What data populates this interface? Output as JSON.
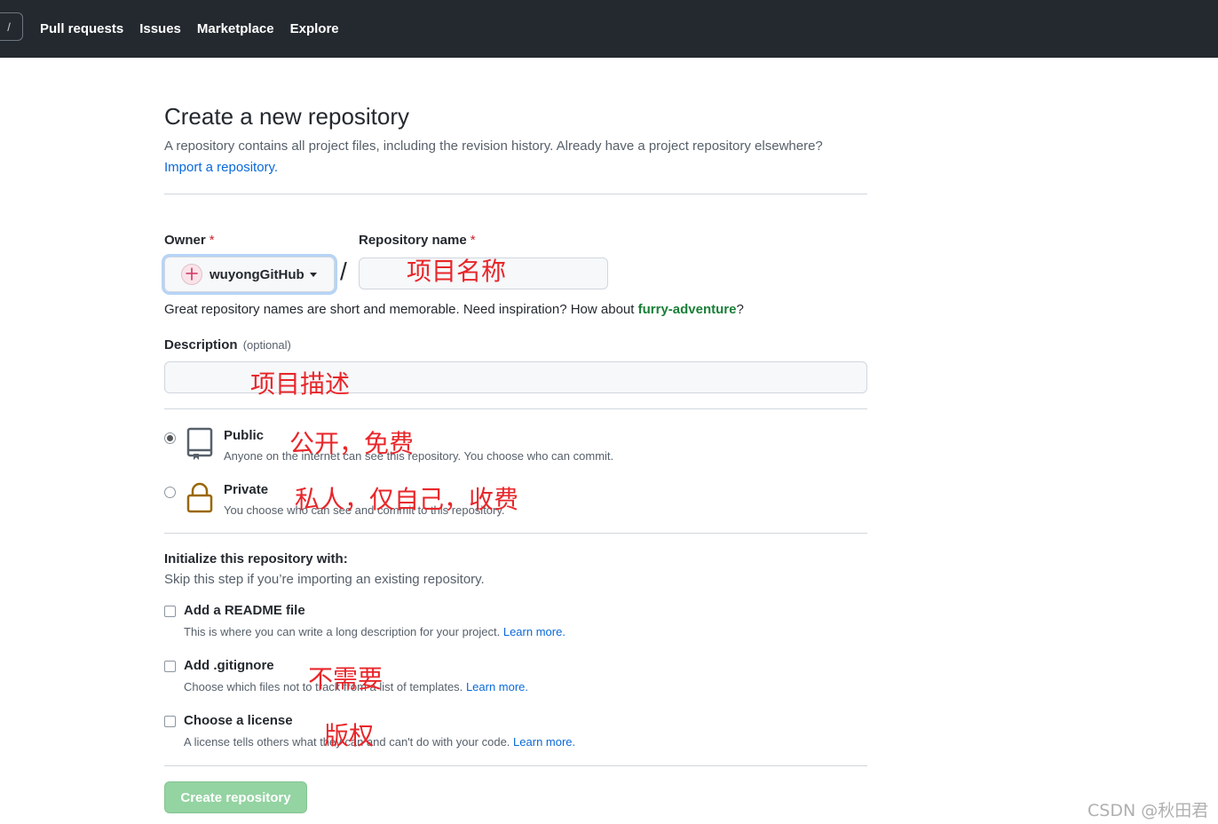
{
  "header": {
    "shortcut_key": "/",
    "nav": [
      "Pull requests",
      "Issues",
      "Marketplace",
      "Explore"
    ]
  },
  "page": {
    "title": "Create a new repository",
    "subtitle": "A repository contains all project files, including the revision history. Already have a project repository elsewhere?",
    "import_link": "Import a repository."
  },
  "owner": {
    "label": "Owner",
    "required_mark": "*",
    "value": "wuyongGitHub",
    "avatar_glyph": "十"
  },
  "separator": "/",
  "repo_name": {
    "label": "Repository name",
    "required_mark": "*",
    "value": ""
  },
  "name_hint": {
    "prefix": "Great repository names are short and memorable. Need inspiration? How about ",
    "suggestion": "furry-adventure",
    "suffix": "?"
  },
  "description": {
    "label": "Description",
    "optional": "(optional)",
    "value": ""
  },
  "visibility": {
    "public": {
      "title": "Public",
      "desc": "Anyone on the internet can see this repository. You choose who can commit.",
      "checked": true,
      "icon": "repo-icon"
    },
    "private": {
      "title": "Private",
      "desc": "You choose who can see and commit to this repository.",
      "checked": false,
      "icon": "lock-icon"
    }
  },
  "init": {
    "title": "Initialize this repository with:",
    "subtitle": "Skip this step if you’re importing an existing repository.",
    "options": [
      {
        "title": "Add a README file",
        "desc": "This is where you can write a long description for your project.",
        "link": "Learn more.",
        "checked": false
      },
      {
        "title": "Add .gitignore",
        "desc": "Choose which files not to track from a list of templates.",
        "link": "Learn more.",
        "checked": false
      },
      {
        "title": "Choose a license",
        "desc": "A license tells others what they can and can't do with your code.",
        "link": "Learn more.",
        "checked": false
      }
    ]
  },
  "submit_label": "Create repository",
  "annotations": {
    "repo_name": "项目名称",
    "description": "项目描述",
    "public": "公开，免费",
    "private": "私人，仅自己，收费",
    "gitignore": "不需要",
    "license": "版权"
  },
  "watermark": "CSDN @秋田君",
  "colors": {
    "header_bg": "#24292f",
    "link": "#0969da",
    "suggestion": "#1a7f37",
    "button_disabled": "#94d3a2",
    "annotation": "#e8262a",
    "required": "#cf222e"
  }
}
